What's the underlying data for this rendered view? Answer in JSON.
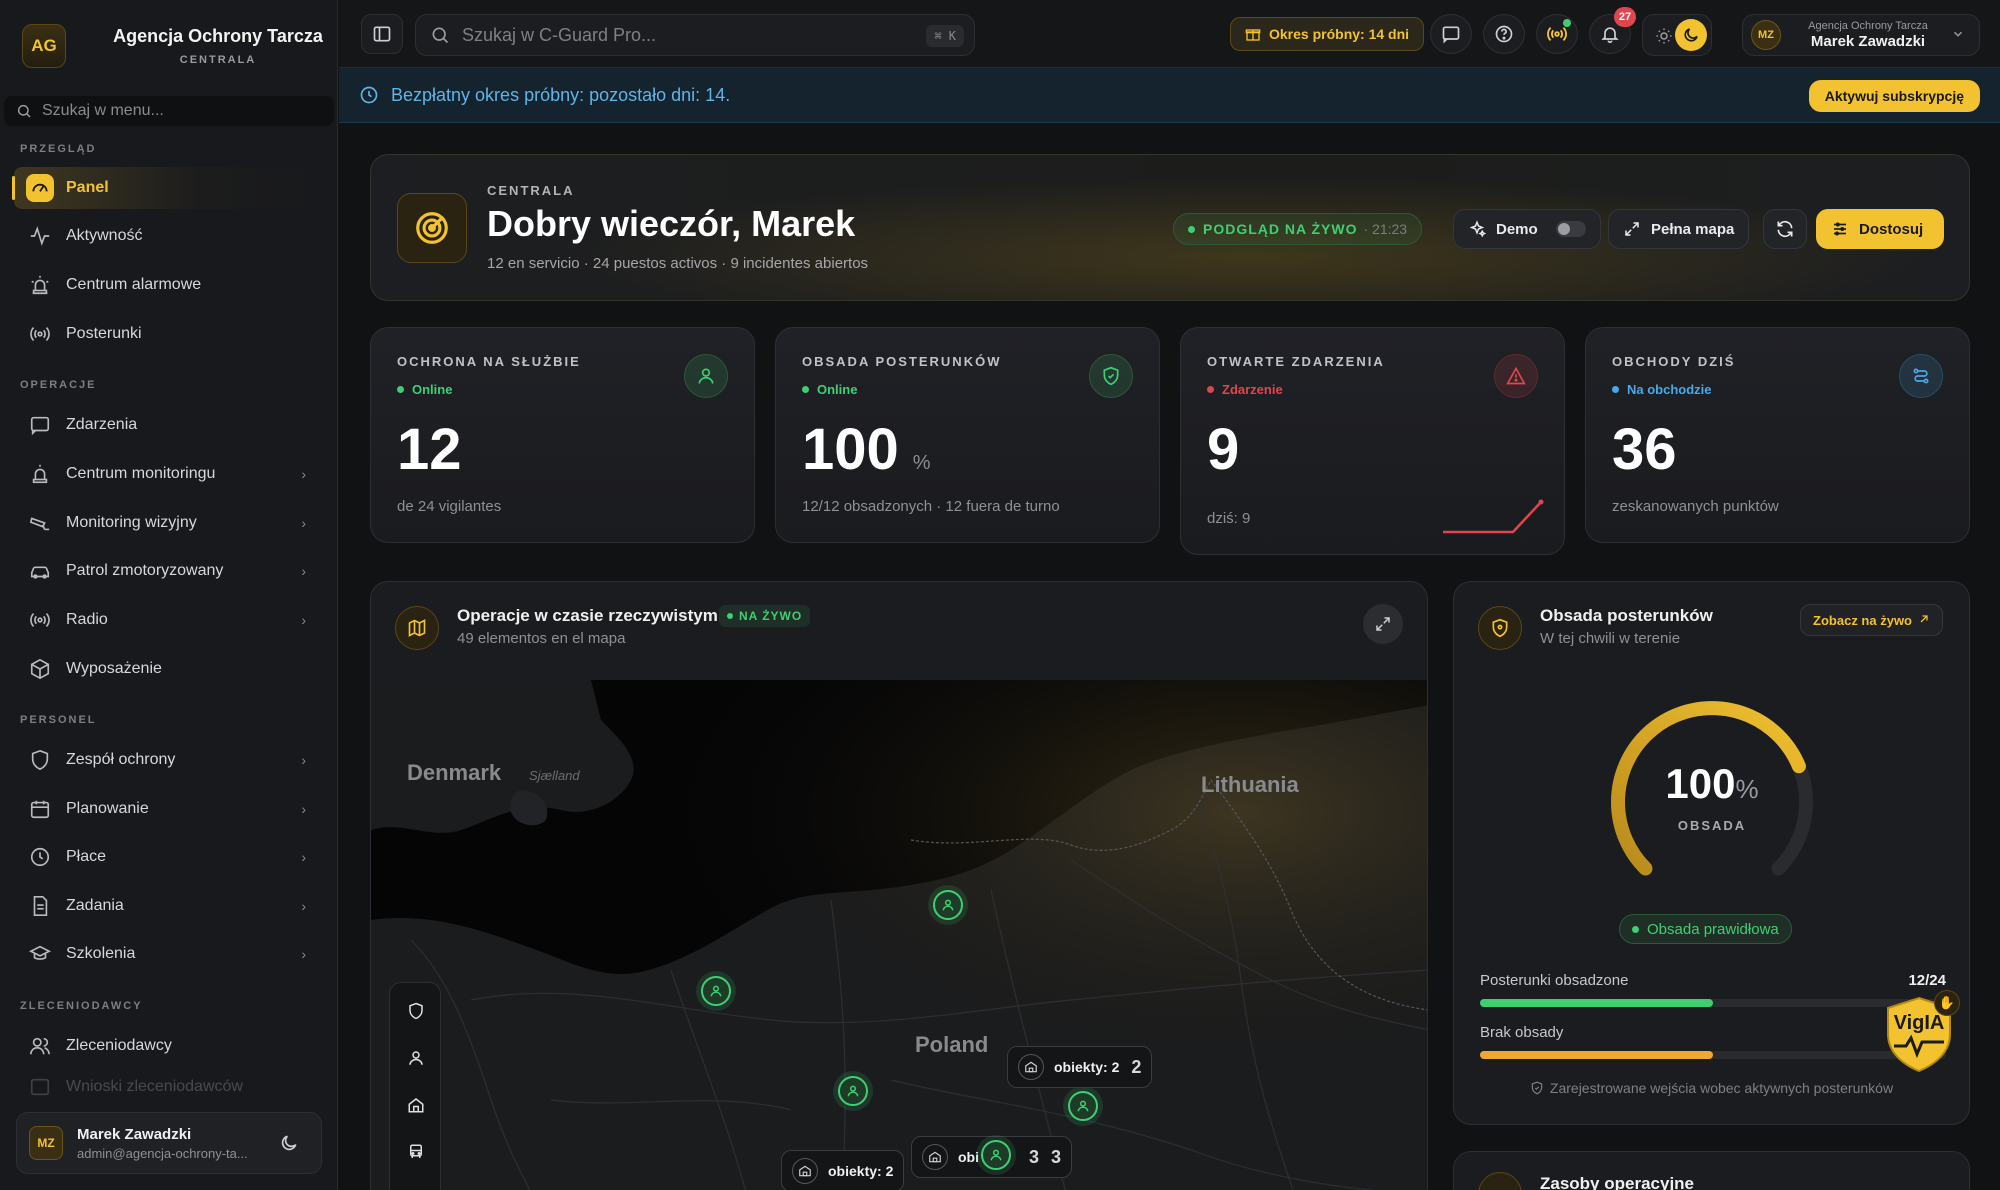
{
  "brand": {
    "initials": "AG",
    "name": "Agencja Ochrony Tarcza",
    "subtitle": "CENTRALA"
  },
  "sidebar": {
    "search_placeholder": "Szukaj w menu...",
    "sections": {
      "overview": "PRZEGLĄD",
      "operations": "OPERACJE",
      "staff": "PERSONEL",
      "clients": "ZLECENIODAWCY"
    },
    "items": [
      {
        "label": "Panel",
        "icon": "gauge-icon",
        "active": true
      },
      {
        "label": "Aktywność",
        "icon": "activity-icon"
      },
      {
        "label": "Centrum alarmowe",
        "icon": "siren-icon"
      },
      {
        "label": "Posterunki",
        "icon": "radio-waves-icon"
      },
      {
        "label": "Zdarzenia",
        "icon": "message-square-icon"
      },
      {
        "label": "Centrum monitoringu",
        "icon": "siren-icon",
        "chevron": true
      },
      {
        "label": "Monitoring wizyjny",
        "icon": "cctv-icon",
        "chevron": true
      },
      {
        "label": "Patrol zmotoryzowany",
        "icon": "car-icon",
        "chevron": true
      },
      {
        "label": "Radio",
        "icon": "radio-waves-icon",
        "chevron": true
      },
      {
        "label": "Wyposażenie",
        "icon": "package-icon"
      },
      {
        "label": "Zespół ochrony",
        "icon": "shield-icon",
        "chevron": true
      },
      {
        "label": "Planowanie",
        "icon": "calendar-icon",
        "chevron": true
      },
      {
        "label": "Płace",
        "icon": "clock-icon",
        "chevron": true
      },
      {
        "label": "Zadania",
        "icon": "document-icon",
        "chevron": true
      },
      {
        "label": "Szkolenia",
        "icon": "graduation-cap-icon",
        "chevron": true
      },
      {
        "label": "Zleceniodawcy",
        "icon": "users-icon"
      },
      {
        "label": "Wnioski zleceniodawców",
        "icon": "inbox-icon"
      }
    ],
    "user": {
      "initials": "MZ",
      "name": "Marek Zawadzki",
      "email": "admin@agencja-ochrony-ta..."
    }
  },
  "topbar": {
    "search_placeholder": "Szukaj w C-Guard Pro...",
    "shortcut": "⌘ K",
    "trial_label": "Okres próbny: 14 dni",
    "notifications_count": "27",
    "account": {
      "initials": "MZ",
      "org": "Agencja Ochrony Tarcza",
      "name": "Marek Zawadzki"
    }
  },
  "banner": {
    "text": "Bezpłatny okres próbny: pozostało dni: 14.",
    "cta": "Aktywuj subskrypcję"
  },
  "hero": {
    "eyebrow": "CENTRALA",
    "greeting": "Dobry wieczór, Marek",
    "subline": "12 en servicio · 24 puestos activos · 9 incidentes abiertos",
    "live_label": "PODGLĄD NA ŻYWO",
    "live_time": "· 21:23",
    "demo_label": "Demo",
    "fullmap_label": "Pełna mapa",
    "customize_label": "Dostosuj"
  },
  "stats": [
    {
      "label": "OCHRONA NA SŁUŻBIE",
      "status": "Online",
      "status_color": "#3fcf73",
      "value": "12",
      "unit": "",
      "sub": "de 24 vigilantes",
      "icon": "user-icon",
      "accent": "#3fcf73"
    },
    {
      "label": "OBSADA POSTERUNKÓW",
      "status": "Online",
      "status_color": "#3fcf73",
      "value": "100",
      "unit": "%",
      "sub": "12/12 obsadzonych · 12 fuera de turno",
      "icon": "shield-check-icon",
      "accent": "#3fcf73"
    },
    {
      "label": "OTWARTE ZDARZENIA",
      "status": "Zdarzenie",
      "status_color": "#e0464e",
      "value": "9",
      "unit": "",
      "sub": "dziś: 9",
      "icon": "alert-triangle-icon",
      "accent": "#e0464e"
    },
    {
      "label": "OBCHODY DZIŚ",
      "status": "Na obchodzie",
      "status_color": "#4aa8e8",
      "value": "36",
      "unit": "",
      "sub": "zeskanowanych punktów",
      "icon": "route-icon",
      "accent": "#4aa8e8"
    }
  ],
  "map": {
    "title": "Operacje w czasie rzeczywistym",
    "live_badge": "NA ŻYWO",
    "subtitle": "49 elementos en el mapa",
    "labels": {
      "denmark": "Denmark",
      "sjaelland": "Sjælland",
      "lithuania": "Lithuania",
      "poland": "Poland"
    },
    "clusters": [
      {
        "label": "obiekty: 2",
        "count": "2"
      },
      {
        "label": "obi",
        "count": "3"
      },
      {
        "label": "obiekty: 2",
        "count": ""
      }
    ],
    "cluster_extra_count": "3"
  },
  "staffing": {
    "title": "Obsada posterunków",
    "subtitle": "W tej chwili w terenie",
    "link": "Zobacz na żywo",
    "gauge_value": "100",
    "gauge_unit": "%",
    "gauge_label": "OBSADA",
    "gauge_fraction": 0.75,
    "status": "Obsada prawidłowa",
    "bars": [
      {
        "label": "Posterunki obsadzone",
        "value": "12/24",
        "fraction": 0.5,
        "color": "#3fcf73"
      },
      {
        "label": "Brak obsady",
        "value": "",
        "fraction": 0.5,
        "color": "#f0a830"
      }
    ],
    "footer": "Zarejestrowane wejścia wobec aktywnych posterunków",
    "vigia_label": "VigIA"
  },
  "resources": {
    "title": "Zasoby operacyjne"
  }
}
